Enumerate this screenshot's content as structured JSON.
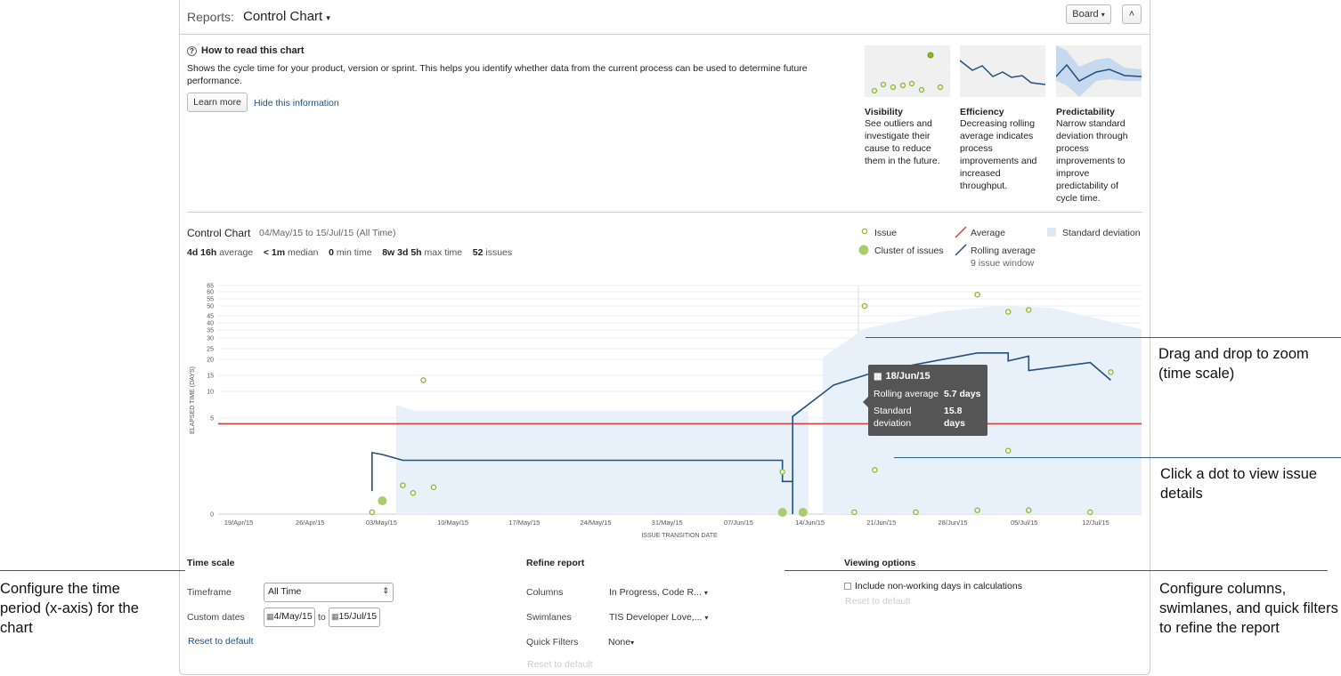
{
  "header": {
    "reports_label": "Reports:",
    "title": "Control Chart",
    "board_button": "Board",
    "collapse_symbol": "˄"
  },
  "howto": {
    "title": "How to read this chart",
    "description": "Shows the cycle time for your product, version or sprint. This helps you identify whether data from the current process can be used to determine future performance.",
    "learn_more": "Learn more",
    "hide_info": "Hide this information",
    "cards": [
      {
        "title": "Visibility",
        "desc": "See outliers and investigate their cause to reduce them in the future."
      },
      {
        "title": "Efficiency",
        "desc": "Decreasing rolling average indicates process improvements and increased throughput."
      },
      {
        "title": "Predictability",
        "desc": "Narrow standard deviation through process improvements to improve predictability of cycle time."
      }
    ]
  },
  "control_chart": {
    "title": "Control Chart",
    "range": "04/May/15 to 15/Jul/15 (All Time)",
    "stats": [
      {
        "value": "4d 16h",
        "label": "average"
      },
      {
        "value": "< 1m",
        "label": "median"
      },
      {
        "value": "0",
        "label": "min time"
      },
      {
        "value": "8w 3d 5h",
        "label": "max time"
      },
      {
        "value": "52",
        "label": "issues"
      }
    ],
    "legend": {
      "issue": "Issue",
      "cluster": "Cluster of issues",
      "average": "Average",
      "rolling": "Rolling average",
      "rolling_sub": "9 issue window",
      "stddev": "Standard deviation"
    }
  },
  "tooltip": {
    "date": "18/Jun/15",
    "rows": [
      {
        "label": "Rolling average",
        "value": "5.7 days"
      },
      {
        "label": "Standard deviation",
        "value": "15.8 days"
      }
    ]
  },
  "chart_data": {
    "type": "scatter",
    "title": "",
    "xlabel": "ISSUE TRANSITION DATE",
    "ylabel": "ELAPSED TIME (DAYS)",
    "x_ticks": [
      "19/Apr/15",
      "26/Apr/15",
      "03/May/15",
      "10/May/15",
      "17/May/15",
      "24/May/15",
      "31/May/15",
      "07/Jun/15",
      "14/Jun/15",
      "21/Jun/15",
      "28/Jun/15",
      "05/Jul/15",
      "12/Jul/15"
    ],
    "y_ticks": [
      "0",
      "5",
      "10",
      "15",
      "20",
      "25",
      "30",
      "35",
      "40",
      "45",
      "50",
      "55",
      "60",
      "65"
    ],
    "y_scale": "nonlinear",
    "average": 4.7,
    "issues": [
      {
        "date": "2015-05-04",
        "days": 0.1
      },
      {
        "date": "2015-05-09",
        "days": 13.5
      },
      {
        "date": "2015-05-07",
        "days": 1.5
      },
      {
        "date": "2015-05-08",
        "days": 1.1
      },
      {
        "date": "2015-05-10",
        "days": 1.4
      },
      {
        "date": "2015-06-13",
        "days": 2.2
      },
      {
        "date": "2015-06-20",
        "days": 0.1
      },
      {
        "date": "2015-06-21",
        "days": 50
      },
      {
        "date": "2015-06-22",
        "days": 2.3
      },
      {
        "date": "2015-06-26",
        "days": 0.1
      },
      {
        "date": "2015-07-02",
        "days": 58
      },
      {
        "date": "2015-07-02",
        "days": 0.2
      },
      {
        "date": "2015-07-05",
        "days": 47
      },
      {
        "date": "2015-07-05",
        "days": 3.3
      },
      {
        "date": "2015-07-07",
        "days": 48
      },
      {
        "date": "2015-07-07",
        "days": 0.2
      },
      {
        "date": "2015-07-13",
        "days": 0.1
      },
      {
        "date": "2015-07-15",
        "days": 16
      }
    ],
    "clusters": [
      {
        "date": "2015-05-05",
        "days": 0.6
      },
      {
        "date": "2015-06-13",
        "days": 0
      },
      {
        "date": "2015-06-15",
        "days": 0
      }
    ],
    "rolling_average": [
      {
        "date": "2015-05-04",
        "days": 1.2
      },
      {
        "date": "2015-05-04",
        "days": 3.2
      },
      {
        "date": "2015-05-05",
        "days": 3.1
      },
      {
        "date": "2015-05-07",
        "days": 2.8
      },
      {
        "date": "2015-06-13",
        "days": 2.8
      },
      {
        "date": "2015-06-13",
        "days": 1.7
      },
      {
        "date": "2015-06-14",
        "days": 1.7
      },
      {
        "date": "2015-06-14",
        "days": 0
      },
      {
        "date": "2015-06-14",
        "days": 5.3
      },
      {
        "date": "2015-06-18",
        "days": 12
      },
      {
        "date": "2015-06-22",
        "days": 16
      },
      {
        "date": "2015-07-02",
        "days": 23
      },
      {
        "date": "2015-07-05",
        "days": 23
      },
      {
        "date": "2015-07-05",
        "days": 19.5
      },
      {
        "date": "2015-07-07",
        "days": 21.5
      },
      {
        "date": "2015-07-07",
        "days": 16.5
      },
      {
        "date": "2015-07-13",
        "days": 19
      },
      {
        "date": "2015-07-15",
        "days": 13.5
      }
    ]
  },
  "time_scale": {
    "title": "Time scale",
    "timeframe_label": "Timeframe",
    "timeframe_value": "All Time",
    "custom_dates_label": "Custom dates",
    "from": "4/May/15",
    "to_label": "to",
    "to": "15/Jul/15",
    "reset": "Reset to default"
  },
  "refine": {
    "title": "Refine report",
    "columns_label": "Columns",
    "columns_value": "In Progress, Code R...",
    "swimlanes_label": "Swimlanes",
    "swimlanes_value": "TIS Developer Love,...",
    "quickfilters_label": "Quick Filters",
    "quickfilters_value": "None",
    "reset": "Reset to default"
  },
  "viewing": {
    "title": "Viewing options",
    "nonworking": "Include non-working days in calculations",
    "reset": "Reset to default"
  },
  "callouts": {
    "drag": "Drag and drop to zoom (time scale)",
    "click": "Click a dot to view issue details",
    "configure_time": "Configure the time period (x-axis) for the chart",
    "configure_columns": "Configure columns, swimlanes, and quick filters to refine the report"
  },
  "colors": {
    "issue": "#8ab829",
    "average": "#d04437",
    "rolling": "#205081",
    "stddev": "#e8f0f9"
  }
}
